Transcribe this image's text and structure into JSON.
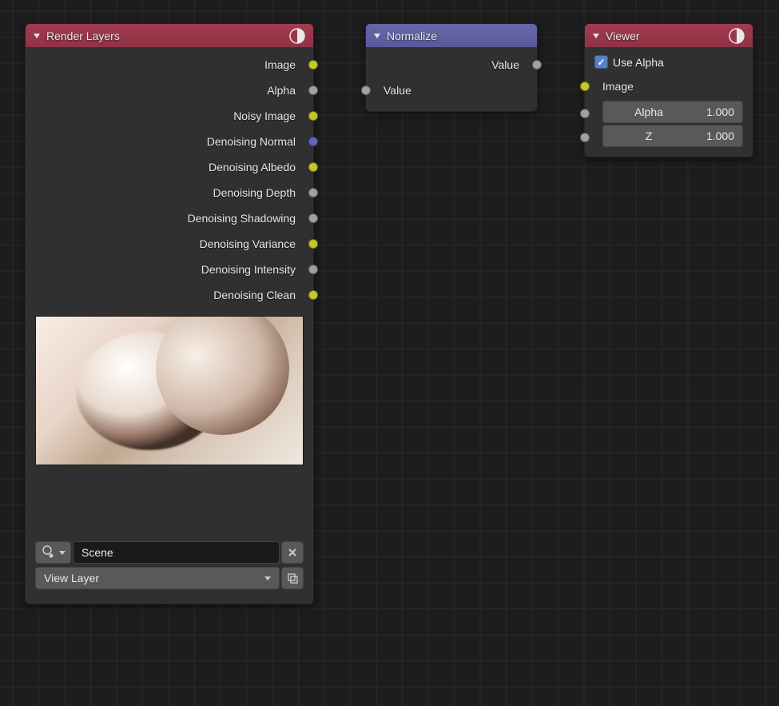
{
  "nodes": {
    "render_layers": {
      "title": "Render Layers",
      "outputs": [
        {
          "label": "Image",
          "color": "yellow"
        },
        {
          "label": "Alpha",
          "color": "gray"
        },
        {
          "label": "Noisy Image",
          "color": "yellow"
        },
        {
          "label": "Denoising Normal",
          "color": "purple"
        },
        {
          "label": "Denoising Albedo",
          "color": "yellow"
        },
        {
          "label": "Denoising Depth",
          "color": "gray"
        },
        {
          "label": "Denoising Shadowing",
          "color": "gray"
        },
        {
          "label": "Denoising Variance",
          "color": "yellow"
        },
        {
          "label": "Denoising Intensity",
          "color": "gray"
        },
        {
          "label": "Denoising Clean",
          "color": "yellow"
        }
      ],
      "scene_field": "Scene",
      "layer_field": "View Layer"
    },
    "normalize": {
      "title": "Normalize",
      "output": {
        "label": "Value",
        "color": "gray"
      },
      "input": {
        "label": "Value",
        "color": "gray"
      }
    },
    "viewer": {
      "title": "Viewer",
      "use_alpha_label": "Use Alpha",
      "use_alpha_checked": true,
      "inputs": [
        {
          "label": "Image",
          "color": "yellow"
        }
      ],
      "num_inputs": [
        {
          "name": "Alpha",
          "value": "1.000",
          "color": "gray"
        },
        {
          "name": "Z",
          "value": "1.000",
          "color": "gray"
        }
      ]
    }
  }
}
